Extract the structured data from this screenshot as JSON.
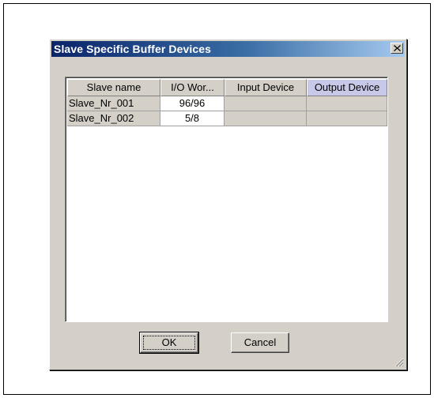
{
  "dialog": {
    "title": "Slave Specific Buffer Devices",
    "ok_label": "OK",
    "cancel_label": "Cancel"
  },
  "table": {
    "columns": [
      "Slave name",
      "I/O Wor...",
      "Input Device",
      "Output Device"
    ],
    "rows": [
      {
        "slave_name": "Slave_Nr_001",
        "io_words": "96/96",
        "input_device": "",
        "output_device": ""
      },
      {
        "slave_name": "Slave_Nr_002",
        "io_words": "5/8",
        "input_device": "",
        "output_device": ""
      }
    ],
    "selected_header": "Output Device"
  },
  "icons": {
    "close": "close-icon",
    "grip": "resize-grip-icon"
  },
  "colors": {
    "title_bar_start": "#0a246a",
    "title_bar_end": "#a6caf0",
    "selected_header": "#c8c8e8",
    "face": "#d4d0c8"
  }
}
